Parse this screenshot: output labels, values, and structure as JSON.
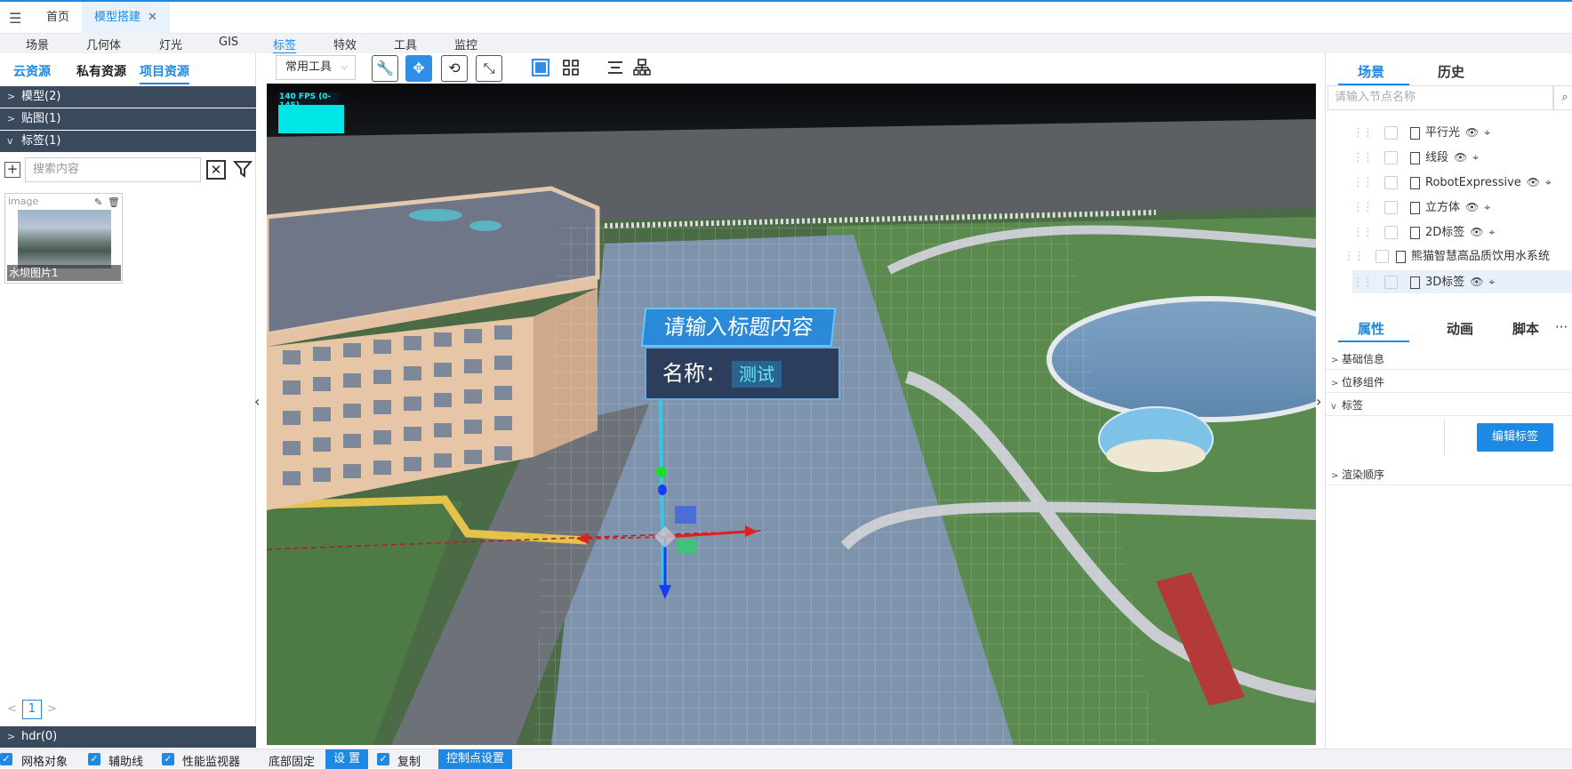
{
  "tabs": [
    {
      "label": "首页",
      "active": false
    },
    {
      "label": "模型搭建",
      "active": true,
      "closable": true
    }
  ],
  "menu": [
    "场景",
    "几何体",
    "灯光",
    "GIS",
    "标签",
    "特效",
    "工具",
    "监控"
  ],
  "menu_active": "标签",
  "left": {
    "tabs": [
      "云资源",
      "私有资源",
      "项目资源"
    ],
    "active_tab": "项目资源",
    "sections": {
      "model": "模型(2)",
      "texture": "贴图(1)",
      "tag": "标签(1)",
      "hdr": "hdr(0)"
    },
    "search_placeholder": "搜索内容",
    "image_card": {
      "label": "image",
      "caption": "水坝图片1"
    },
    "page": "1"
  },
  "toolbar": {
    "select": "常用工具"
  },
  "viewport": {
    "fps": "140 FPS (0-145)",
    "tag_title": "请输入标题内容",
    "tag_name_label": "名称：",
    "tag_name_value": "测试"
  },
  "right": {
    "scene_tab": "场景",
    "history_tab": "历史",
    "search_placeholder": "请输入节点名称",
    "nodes": [
      "平行光",
      "线段",
      "RobotExpressive",
      "立方体",
      "2D标签",
      "熊猫智慧高品质饮用水系统",
      "3D标签"
    ],
    "prop_tabs": [
      "属性",
      "动画",
      "脚本"
    ],
    "more": "···",
    "sections": [
      "基础信息",
      "位移组件",
      "标签",
      "渲染顺序"
    ],
    "edit_tag_button": "编辑标签"
  },
  "bottom": {
    "grid": "网格对象",
    "helper": "辅助线",
    "perf": "性能监视器",
    "fixed": "底部固定",
    "set": "设 置",
    "copy": "复制",
    "control_points": "控制点设置"
  },
  "colors": {
    "accent": "#1e88e5",
    "section_header": "#3a4a5c",
    "tag_blue": "#2a8ad8",
    "fps_cyan": "#00e6e6"
  }
}
